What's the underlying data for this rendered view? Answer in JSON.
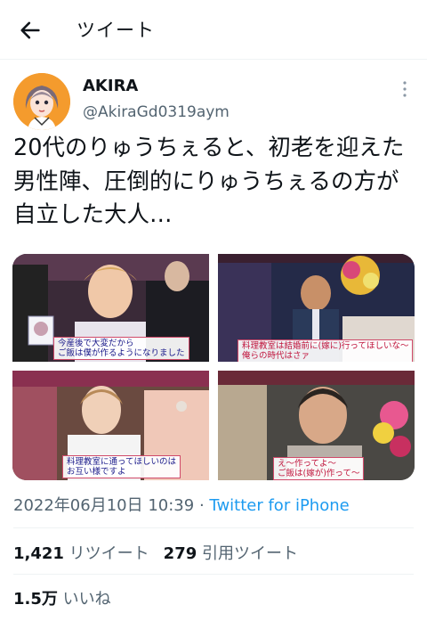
{
  "header": {
    "title": "ツイート"
  },
  "author": {
    "name": "AKIRA",
    "handle": "@AkiraGd0319aym"
  },
  "tweet": {
    "text": "20代のりゅうちぇると、初老を迎えた男性陣、圧倒的にりゅうちぇるの方が自立した大人…"
  },
  "media": [
    {
      "captions": [
        "今産後で大変だから",
        "ご飯は僕が作るようになりました"
      ],
      "caption_color": "blue"
    },
    {
      "captions": [
        "料理教室は結婚前に(嫁に)行ってほしいな～",
        "俺らの時代はさァ"
      ],
      "caption_color": "red"
    },
    {
      "captions": [
        "料理教室に通ってほしいのは",
        "お互い様ですよ"
      ],
      "caption_color": "blue"
    },
    {
      "captions": [
        "え～作ってよ～",
        "ご飯は(嫁が)作って～"
      ],
      "caption_color": "red"
    }
  ],
  "meta": {
    "timestamp": "2022年06月10日 10:39",
    "separator": "·",
    "source": "Twitter for iPhone"
  },
  "stats": {
    "retweets_count": "1,421",
    "retweets_label": "リツイート",
    "quotes_count": "279",
    "quotes_label": "引用ツイート",
    "likes_count": "1.5万",
    "likes_label": "いいね"
  }
}
